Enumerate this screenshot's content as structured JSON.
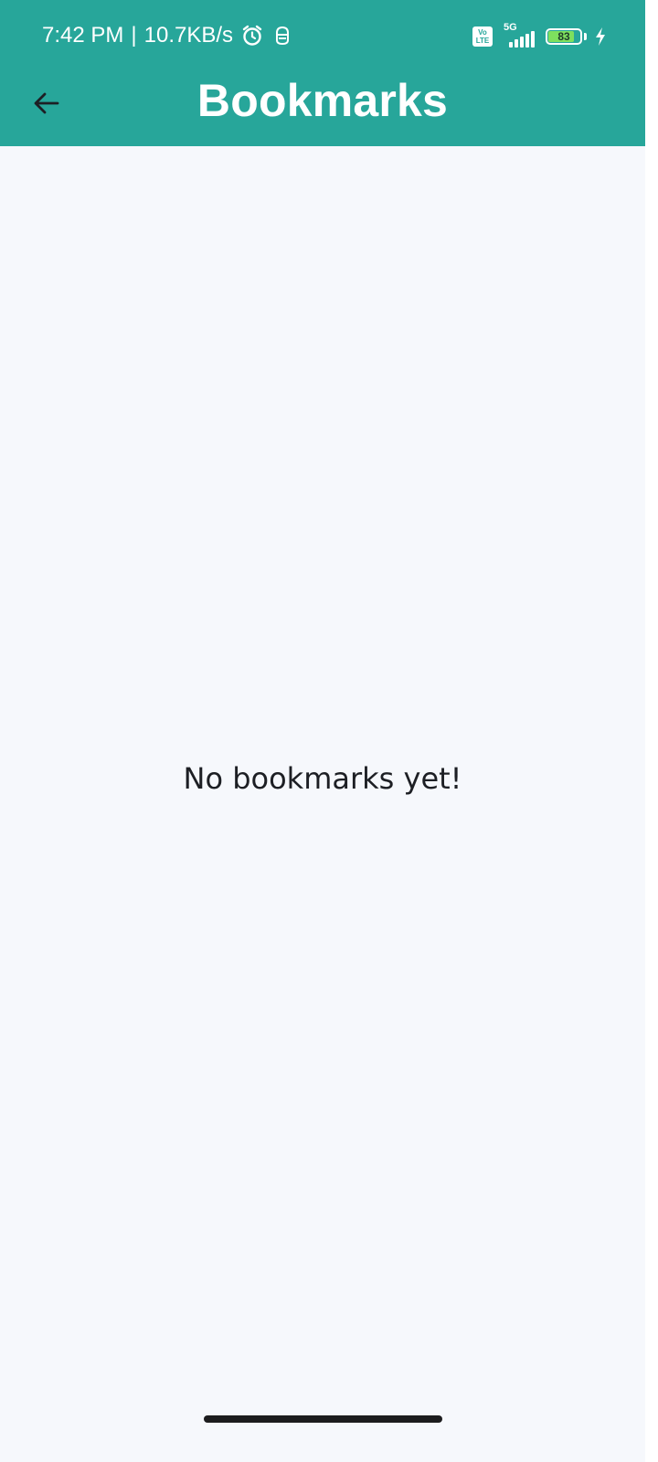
{
  "status_bar": {
    "time": "7:42 PM",
    "separator": "|",
    "network_speed": "10.7KB/s",
    "alarm_icon": "alarm-icon",
    "app_icon": "notification-app-icon",
    "volte_top": "Vo",
    "volte_bottom": "LTE",
    "network_type": "5G",
    "battery_percent": "83",
    "battery_level": 0.83,
    "charging_icon": "bolt-icon"
  },
  "app_bar": {
    "back_icon": "arrow-left-icon",
    "title": "Bookmarks"
  },
  "content": {
    "empty_message": "No bookmarks yet!"
  },
  "colors": {
    "header_bg": "#27a69a",
    "page_bg": "#f6f8fc",
    "text": "#1d1f24",
    "battery_fill": "#7ee05e"
  }
}
